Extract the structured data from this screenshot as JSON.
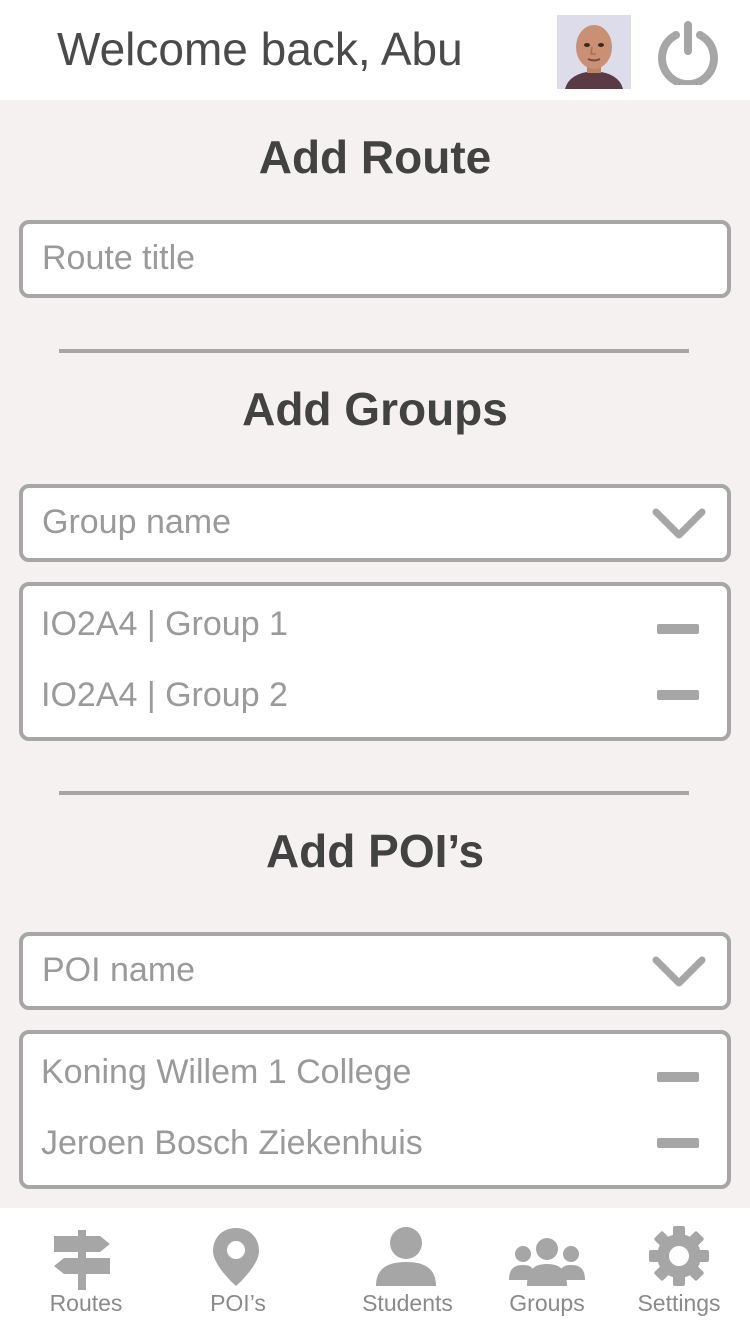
{
  "header": {
    "welcome": "Welcome back, Abu"
  },
  "route": {
    "title": "Add Route",
    "input_placeholder": "Route title"
  },
  "groups": {
    "title": "Add Groups",
    "select_placeholder": "Group name",
    "items": [
      "IO2A4 | Group 1",
      "IO2A4 | Group 2"
    ]
  },
  "pois": {
    "title": "Add POI’s",
    "select_placeholder": "POI name",
    "items": [
      "Koning Willem 1 College",
      "Jeroen Bosch Ziekenhuis"
    ]
  },
  "tabbar": {
    "tabs": [
      {
        "label": "Routes",
        "icon": "signpost-icon"
      },
      {
        "label": "POI’s",
        "icon": "map-pin-icon"
      },
      {
        "label": "Students",
        "icon": "person-icon"
      },
      {
        "label": "Groups",
        "icon": "group-icon"
      },
      {
        "label": "Settings",
        "icon": "gear-icon"
      }
    ]
  },
  "colors": {
    "background": "#f4f1f0",
    "border": "#a6a6a6",
    "text_dark": "#424242",
    "text_muted": "#9a9a9a"
  }
}
